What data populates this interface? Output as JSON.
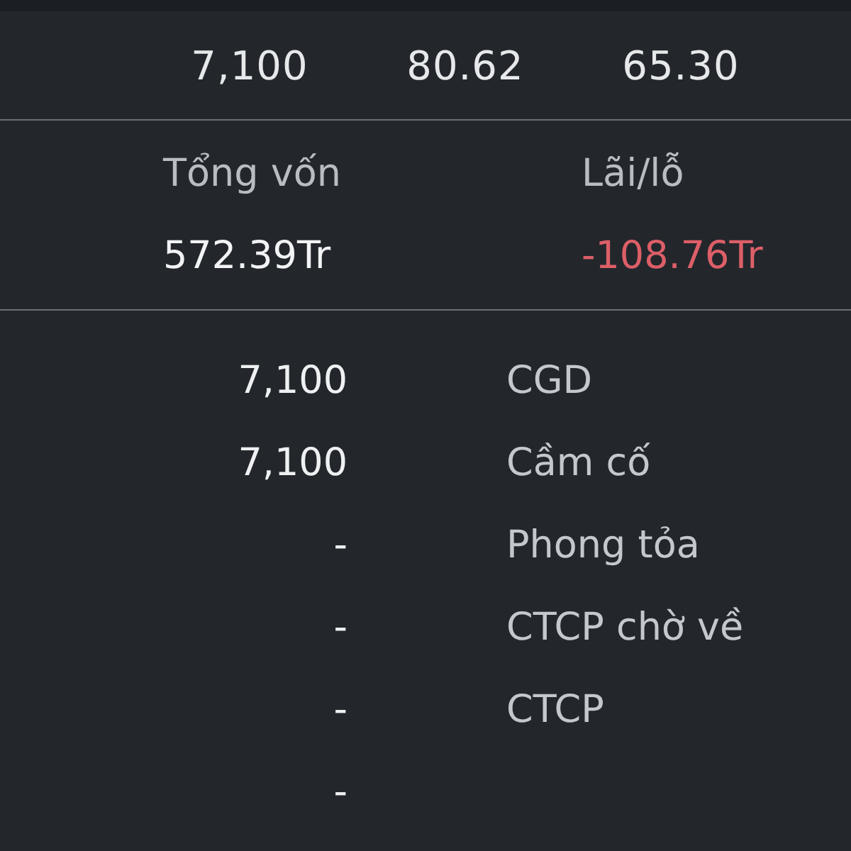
{
  "top_values": [
    "7,100",
    "80.62",
    "65.30"
  ],
  "summary": [
    {
      "label": "Tổng vốn",
      "value": "572.39Tr",
      "color": "#f2f3f4"
    },
    {
      "label": "Lãi/lỗ",
      "value": "-108.76Tr",
      "color": "#dd5f68"
    }
  ],
  "holdings": [
    {
      "value": "7,100",
      "label": "CGD"
    },
    {
      "value": "7,100",
      "label": "Cầm cố"
    },
    {
      "value": "-",
      "label": "Phong tỏa"
    },
    {
      "value": "-",
      "label": "CTCP chờ về"
    },
    {
      "value": "-",
      "label": "CTCP"
    },
    {
      "value": "-"
    }
  ]
}
